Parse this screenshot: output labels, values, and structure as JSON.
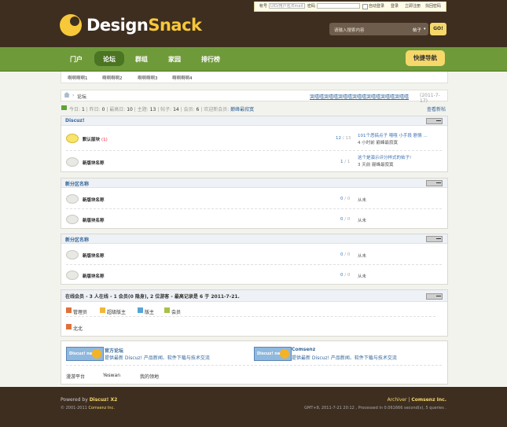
{
  "header": {
    "logo_text_1": "Design",
    "logo_text_2": "Snack",
    "login": {
      "account_label": "帐号",
      "account_placeholder": "UID/用户名/Email",
      "password_label": "密码",
      "auto_login": "自动登录",
      "login_button": "登录",
      "register": "立即注册",
      "forgot": "找回密码"
    },
    "search": {
      "placeholder": "请输入搜索内容",
      "type": "帖子",
      "button": "GO!"
    }
  },
  "nav": {
    "items": [
      "门户",
      "论坛",
      "群组",
      "家园",
      "排行榜"
    ],
    "active": "论坛",
    "quick_nav": "快捷导航"
  },
  "subnav": [
    "啊啊啊啊1",
    "啊啊啊啊2",
    "啊啊啊啊3",
    "啊啊啊啊4"
  ],
  "breadcrumb": {
    "current": "论坛",
    "announcement": "哭嘻嘻哭嘻嘻哭嘻嘻哭嘻嘻哭嘻嘻哭嘻嘻哭嘻嘻",
    "announcement_date": "(2011-7-17)"
  },
  "stats": {
    "today_label": "今日:",
    "today": "1",
    "yesterday_label": "昨日:",
    "yesterday": "0",
    "max_label": "最高日:",
    "max": "10",
    "threads_label": "主题:",
    "threads": "13",
    "posts_label": "帖子:",
    "posts": "14",
    "members_label": "会员:",
    "members": "6",
    "welcome_label": "欢迎新会员:",
    "welcome": "巅峰最寂寞",
    "new_posts_link": "查看新帖"
  },
  "categories": [
    {
      "name": "Discuz!",
      "forums": [
        {
          "name": "默认版块",
          "today": "(1)",
          "threads": "12",
          "posts": "13",
          "last_title": "101个恶搞点子 嘻嘻 小手段 剧情 ...",
          "last_time": "4 小时前",
          "last_user": "巅峰最寂寞"
        },
        {
          "name": "新版块名称",
          "today": "",
          "threads": "1",
          "posts": "1",
          "last_title": "这个是演示评分样式的帖子!",
          "last_time": "3 天前",
          "last_user": "巅峰最寂寞"
        }
      ]
    },
    {
      "name": "新分区名称",
      "forums": [
        {
          "name": "新版块名称",
          "threads": "0",
          "posts": "0",
          "last": "从未"
        },
        {
          "name": "新版块名称",
          "threads": "0",
          "posts": "0",
          "last": "从未"
        }
      ]
    },
    {
      "name": "新分区名称",
      "forums": [
        {
          "name": "新版块名称",
          "threads": "0",
          "posts": "0",
          "last": "从未"
        },
        {
          "name": "新版块名称",
          "threads": "0",
          "posts": "0",
          "last": "从未"
        }
      ]
    }
  ],
  "online": {
    "title": "在线会员 - 3 人在线 - 1 会员(0 隐身), 2 位游客 - 最高记录是 6 于 2011-7-21.",
    "legend": [
      "管理员",
      "超级版主",
      "版主",
      "会员"
    ],
    "users": [
      "北北"
    ]
  },
  "links": {
    "items": [
      {
        "name": "官方论坛",
        "desc": "提供最新 Discuz! 产品新闻、软件下载与技术交流",
        "logo": "Discuz! net"
      },
      {
        "name": "Comsenz",
        "desc": "提供最新 Discuz! 产品新闻、软件下载与技术交流",
        "logo": "Discuz! net"
      }
    ],
    "text_links": [
      "漫游平台",
      "Yeswan",
      "我的领地"
    ]
  },
  "footer": {
    "powered_by": "Powered by",
    "product": "Discuz! X2",
    "copyright": "© 2001-2011",
    "company": "Comsenz Inc.",
    "archiver": "Archiver",
    "company_link": "Comsenz Inc.",
    "debug": "GMT+8, 2011-7-21 20:12 , Processed in 0.061666 second(s), 5 queries ."
  },
  "colors": {
    "header_bg": "#3e2e20",
    "nav_green": "#6f9a3a",
    "link_blue": "#336699",
    "accent_yellow": "#f6d86a"
  }
}
